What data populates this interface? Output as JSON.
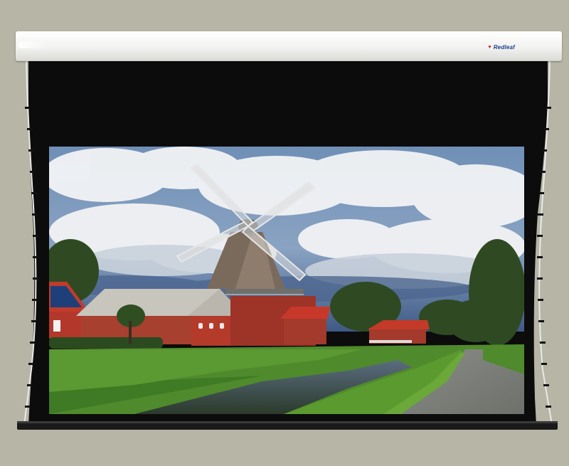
{
  "brand": {
    "name": "Redleaf",
    "logo_icon": "heart-icon",
    "logo_color": "#c8192a",
    "text_color": "#1f3e8c"
  },
  "scene": {
    "subject": "windmill-landscape",
    "sky_color": "#5a7ca3",
    "roof_color": "#c23a25",
    "grass_color": "#4f8a2c"
  }
}
